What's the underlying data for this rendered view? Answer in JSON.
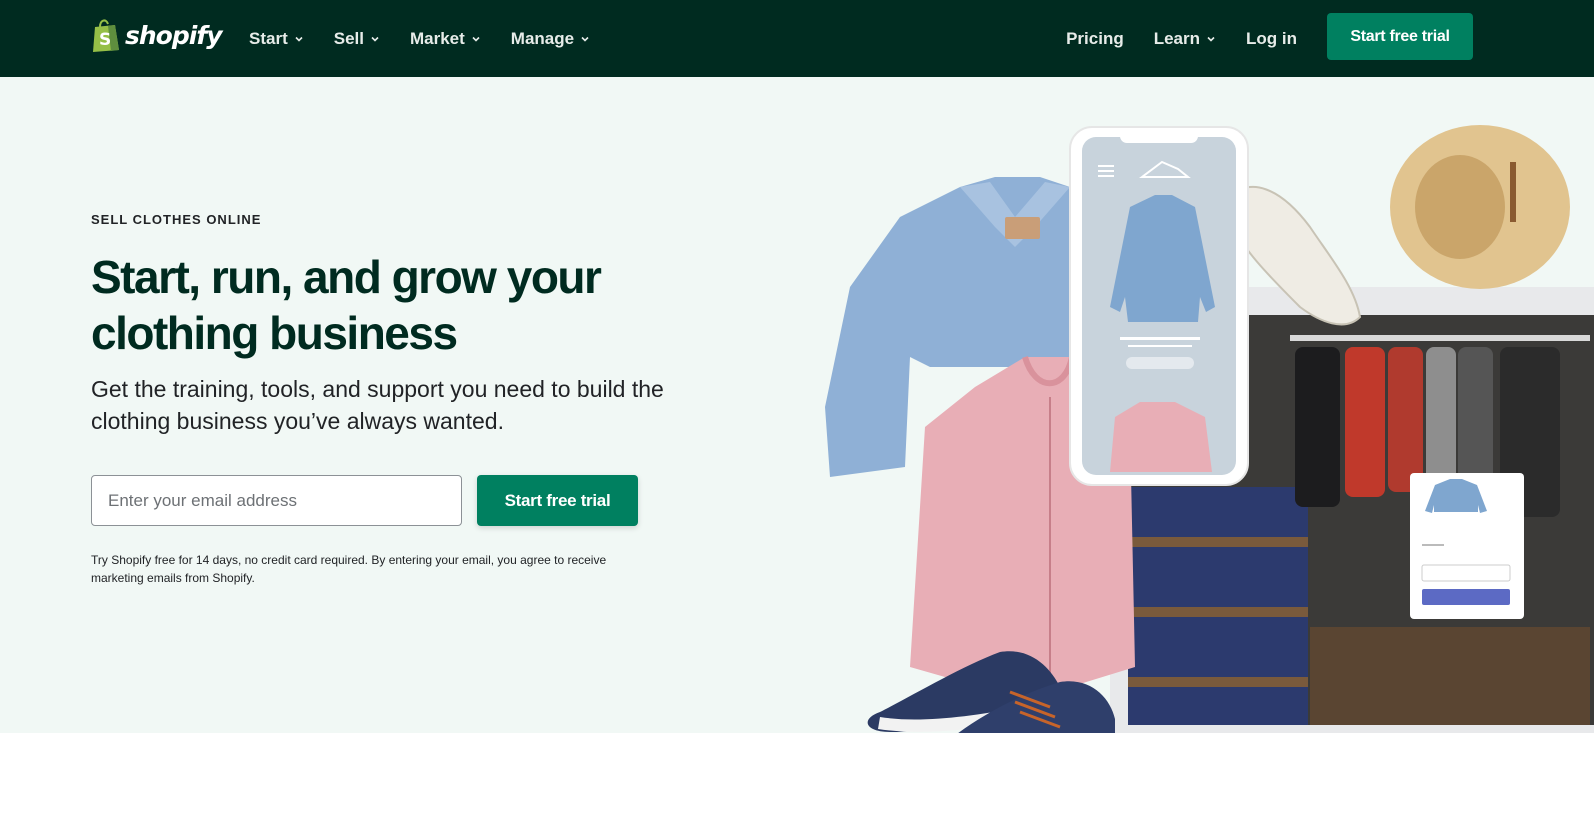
{
  "brand": {
    "name": "shopify",
    "color": "#008060",
    "nav_bg": "#002b20",
    "hero_bg": "#f1f8f5"
  },
  "nav": {
    "left_items": [
      {
        "label": "Start",
        "icon": "chevron-down-icon"
      },
      {
        "label": "Sell",
        "icon": "chevron-down-icon"
      },
      {
        "label": "Market",
        "icon": "chevron-down-icon"
      },
      {
        "label": "Manage",
        "icon": "chevron-down-icon"
      }
    ],
    "pricing": "Pricing",
    "learn": "Learn",
    "login": "Log in",
    "cta": "Start free trial"
  },
  "hero": {
    "eyebrow": "SELL CLOTHES ONLINE",
    "headline": "Start, run, and grow your clothing business",
    "subhead": "Get the training, tools, and support you need to build the clothing business you’ve always wanted.",
    "email_placeholder": "Enter your email address",
    "cta": "Start free trial",
    "disclaimer": "Try Shopify free for 14 days, no credit card required. By entering your email, you agree to receive marketing emails from Shopify."
  }
}
